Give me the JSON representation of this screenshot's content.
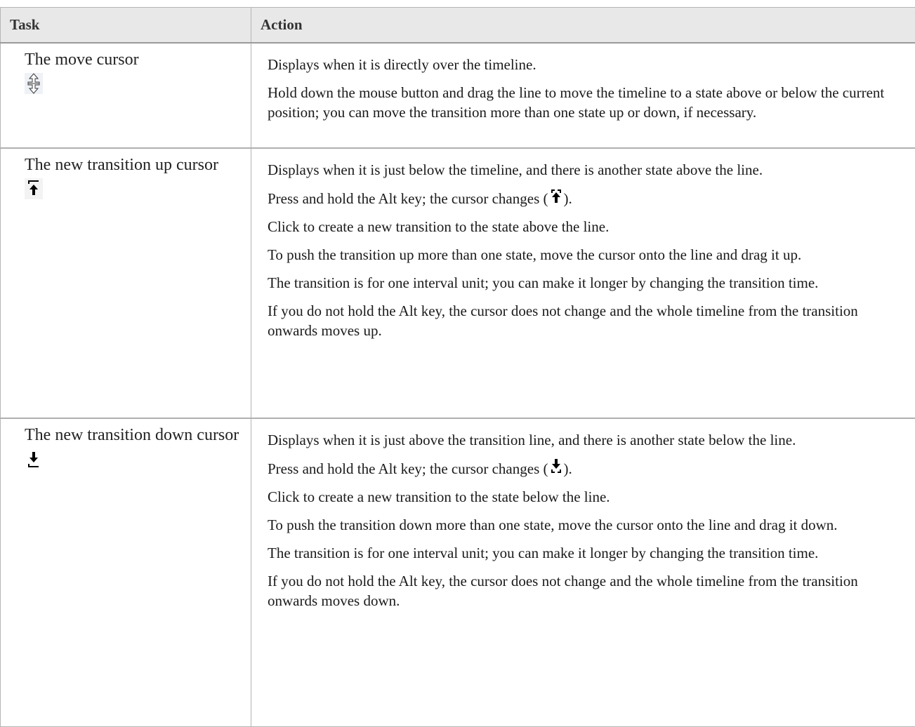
{
  "table": {
    "headers": {
      "task": "Task",
      "action": "Action"
    },
    "rows": [
      {
        "task": "The move cursor",
        "icon": "move-cursor-icon",
        "paragraphs": [
          "Displays when it is directly over the timeline.",
          "Hold down the mouse button and drag the line to move the timeline to a state above or below the current position; you can move the transition more than one state up or down, if necessary."
        ]
      },
      {
        "task": "The new transition up cursor",
        "icon": "transition-up-cursor-icon",
        "paragraphs": [
          "Displays when it is just below the timeline, and there is another state above the line.",
          "Press and hold the Alt key; the cursor changes (",
          ").",
          "Click to create a new transition to the state above the line.",
          "To push the transition up more than one state, move the cursor onto the line and drag it up.",
          "The transition is for one interval unit; you can make it longer by changing the transition time.",
          "If you do not hold the Alt key, the cursor does not change and the whole timeline from the transition onwards moves up."
        ]
      },
      {
        "task": "The new transition down cursor",
        "icon": "transition-down-cursor-icon",
        "paragraphs": [
          "Displays when it is just above the transition line, and there is another state below the line.",
          "Press and hold the Alt key; the cursor changes (",
          ").",
          "Click to create a new transition to the state below the line.",
          "To push the transition down more than one state, move the cursor onto the line and drag it down.",
          "The transition is for one interval unit; you can make it longer by changing the transition time.",
          "If you do not hold the Alt key, the cursor does not change and the whole timeline from the transition onwards moves down."
        ]
      }
    ]
  }
}
